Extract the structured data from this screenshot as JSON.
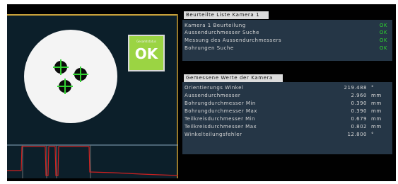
{
  "camera_view": {
    "ok_badge": {
      "sublabel": "Gesamtstatus",
      "label": "OK",
      "color": "#9bd443"
    }
  },
  "rating_list": {
    "title": "Beurteilte Liste Kamera 1",
    "rows": [
      {
        "label": "Kamera 1 Beurteilung",
        "status": "OK"
      },
      {
        "label": "Aussendurchmesser Suche",
        "status": "OK"
      },
      {
        "label": "Messung des Aussendurchmessers",
        "status": "OK"
      },
      {
        "label": "Bohrungen Suche",
        "status": "OK"
      }
    ]
  },
  "measured_values": {
    "title": "Gemessene Werte der Kamera",
    "rows": [
      {
        "label": "Orientierungs Winkel",
        "value": "219.488",
        "unit": "°"
      },
      {
        "label": "Aussendurchmesser",
        "value": "2.960",
        "unit": "mm"
      },
      {
        "label": "Bohrungdurchmesser Min",
        "value": "0.390",
        "unit": "mm"
      },
      {
        "label": "Bohrungdurchmesser Max",
        "value": "0.390",
        "unit": "mm"
      },
      {
        "label": "Teilkreisdurchmesser Min",
        "value": "0.679",
        "unit": "mm"
      },
      {
        "label": "Teilkreisdurchmesser Max",
        "value": "0.802",
        "unit": "mm"
      },
      {
        "label": "Winkelteilungsfehler",
        "value": "12.800",
        "unit": "°"
      }
    ]
  },
  "colors": {
    "status_ok": "#2ed62e",
    "panel_bg": "#253646",
    "header_bg": "#dcdcdc",
    "graph_line": "#d02020"
  }
}
